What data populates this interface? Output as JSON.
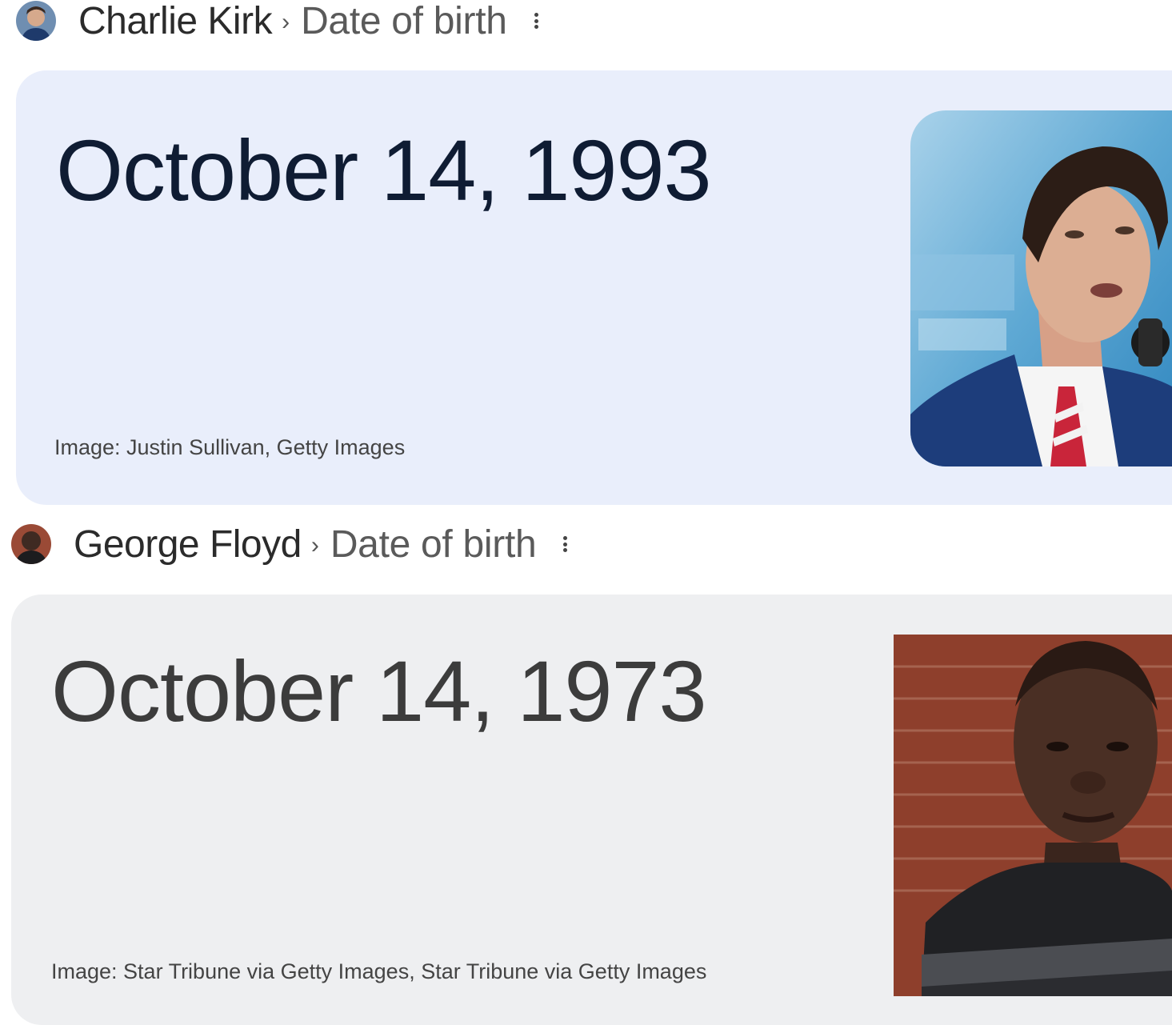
{
  "results": [
    {
      "entity": "Charlie Kirk",
      "separator": "›",
      "attribute": "Date of birth",
      "answer": "October 14, 1993",
      "image_caption": "Image: Justin Sullivan, Getty Images",
      "menu_icon": "more-vert-icon",
      "card_color": "#e9eefb",
      "answer_color": "#0f1c33"
    },
    {
      "entity": "George Floyd",
      "separator": "›",
      "attribute": "Date of birth",
      "answer": "October 14, 1973",
      "image_caption": "Image: Star Tribune via Getty Images, Star Tribune via Getty Images",
      "menu_icon": "more-vert-icon",
      "card_color": "#eeeff1",
      "answer_color": "#3c3c3c"
    }
  ]
}
